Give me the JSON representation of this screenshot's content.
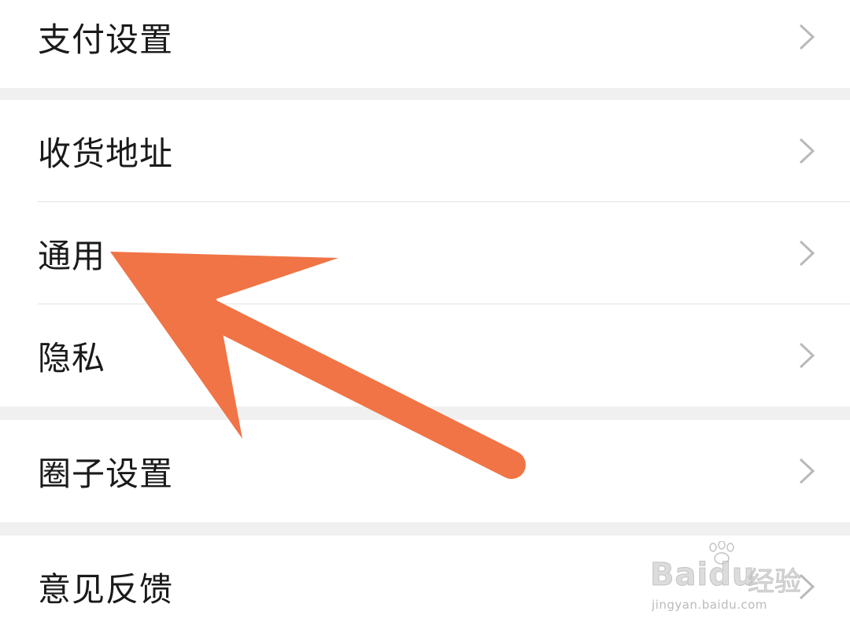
{
  "settings": {
    "items": [
      {
        "label": "支付设置",
        "icon": "chevron-right-icon"
      },
      {
        "label": "收货地址",
        "icon": "chevron-right-icon"
      },
      {
        "label": "通用",
        "icon": "chevron-right-icon"
      },
      {
        "label": "隐私",
        "icon": "chevron-right-icon"
      },
      {
        "label": "圈子设置",
        "icon": "chevron-right-icon"
      },
      {
        "label": "意见反馈",
        "icon": "chevron-right-icon"
      }
    ]
  },
  "annotation": {
    "arrow_color": "#f07445",
    "points_to": "通用"
  },
  "watermark": {
    "brand": "Baidu",
    "name": "经验",
    "url": "jingyan.baidu.com"
  },
  "colors": {
    "background": "#f0f0f0",
    "row_background": "#ffffff",
    "divider": "#e2e2e2",
    "chevron": "#b9b9b9",
    "text": "#1a1a1a"
  }
}
